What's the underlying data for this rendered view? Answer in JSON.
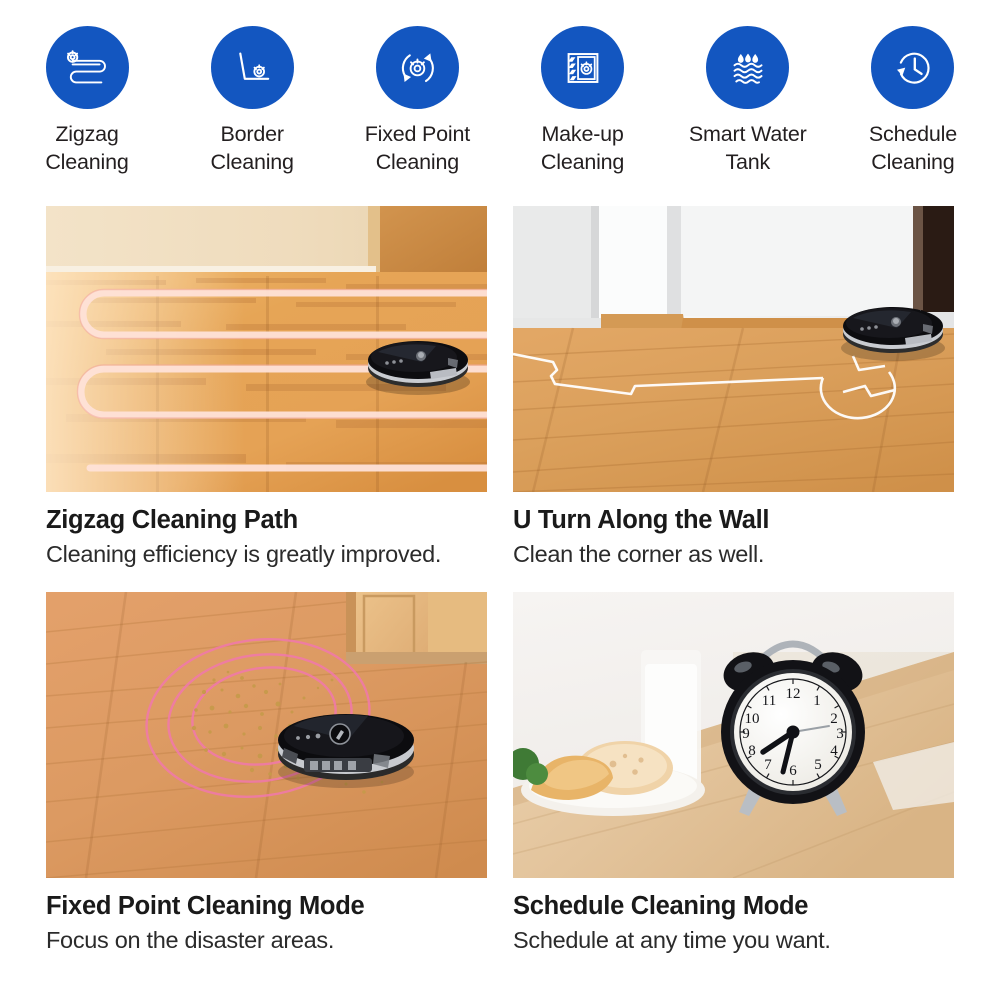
{
  "features": [
    {
      "icon": "zigzag-path-icon",
      "label": "Zigzag\nCleaning"
    },
    {
      "icon": "border-cleaning-icon",
      "label": "Border\nCleaning"
    },
    {
      "icon": "fixed-point-icon",
      "label": "Fixed Point\nCleaning"
    },
    {
      "icon": "make-up-cleaning-icon",
      "label": "Make-up\nCleaning"
    },
    {
      "icon": "water-tank-icon",
      "label": "Smart Water\nTank"
    },
    {
      "icon": "schedule-clock-icon",
      "label": "Schedule\nCleaning"
    }
  ],
  "cards": [
    {
      "photo": "zigzag-path-photo",
      "title": "Zigzag Cleaning Path",
      "subtitle": "Cleaning efficiency is greatly improved."
    },
    {
      "photo": "u-turn-wall-photo",
      "title": "U Turn Along the Wall",
      "subtitle": "Clean the corner as well."
    },
    {
      "photo": "fixed-point-photo",
      "title": "Fixed Point Cleaning Mode",
      "subtitle": "Focus on the disaster areas."
    },
    {
      "photo": "schedule-clock-photo",
      "title": "Schedule Cleaning Mode",
      "subtitle": "Schedule at any time you want."
    }
  ],
  "colors": {
    "badge_blue": "#1356c0",
    "title_text": "#1a1a1a",
    "body_text": "#2b2b2b",
    "page_background": "#ffffff",
    "path_overlay": "#ffe2d8",
    "ripple_pink": "#f07aa8"
  }
}
